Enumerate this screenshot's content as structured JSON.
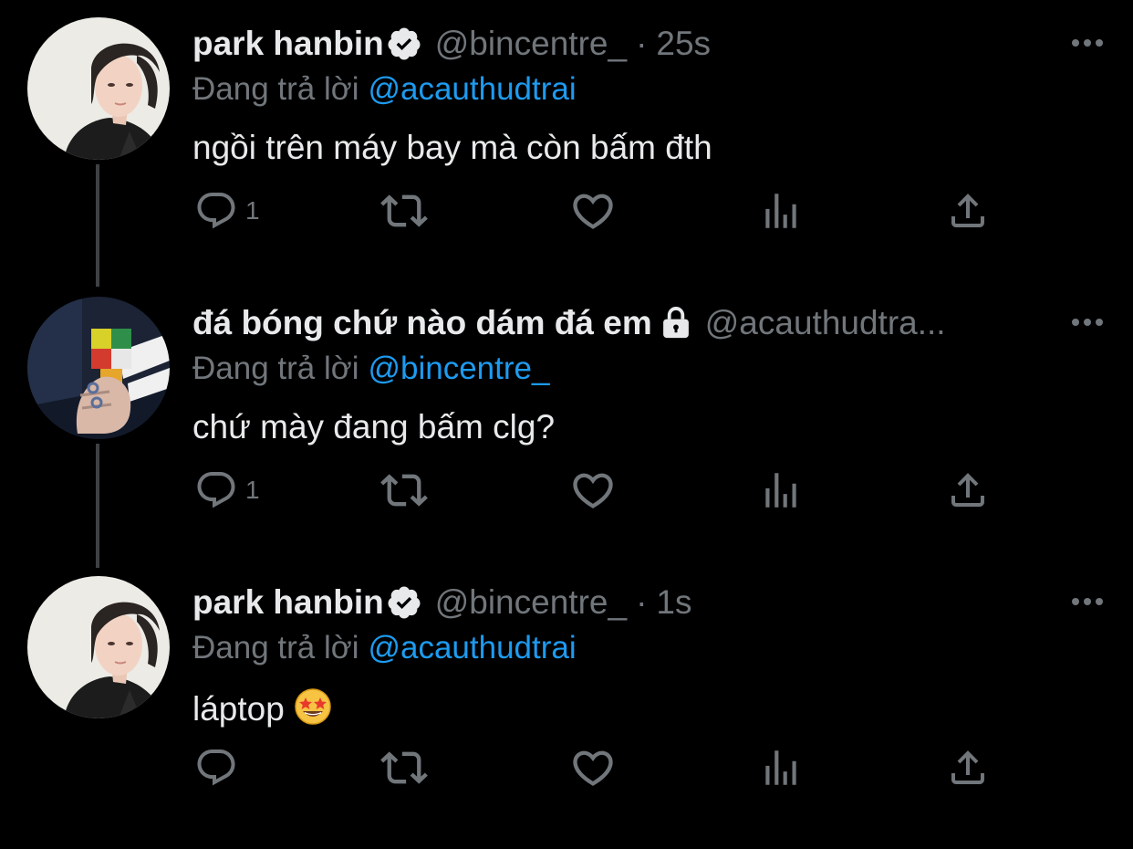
{
  "reply_prefix": "Đang trả lời",
  "tweets": [
    {
      "display_name": "park hanbin",
      "verified": true,
      "handle": "@bincentre_",
      "separator": "·",
      "timestamp": "25s",
      "replying_to": "@acauthudtrai",
      "text": "ngồi trên máy bay mà còn bấm đth",
      "reply_count": "1",
      "avatar": "person-portrait-avatar"
    },
    {
      "display_name": "đá bóng chứ nào dám đá em",
      "protected": true,
      "handle": "@acauthudtra...",
      "replying_to": "@bincentre_",
      "text": "chứ mày đang bấm clg?",
      "reply_count": "1",
      "avatar": "rubiks-cube-hand-avatar"
    },
    {
      "display_name": "park hanbin",
      "verified": true,
      "handle": "@bincentre_",
      "separator": "·",
      "timestamp": "1s",
      "replying_to": "@acauthudtrai",
      "text": "láptop",
      "emoji": "star-struck-emoji",
      "reply_count": "",
      "avatar": "person-portrait-avatar"
    }
  ],
  "icons": [
    "reply-icon",
    "retweet-icon",
    "like-icon",
    "views-icon",
    "share-icon",
    "more-icon",
    "verified-badge-icon",
    "lock-icon"
  ],
  "colors": {
    "background": "#000000",
    "text_primary": "#e7e9ea",
    "text_secondary": "#71767b",
    "link": "#1d9bf0",
    "thread_line": "#3e4144"
  }
}
